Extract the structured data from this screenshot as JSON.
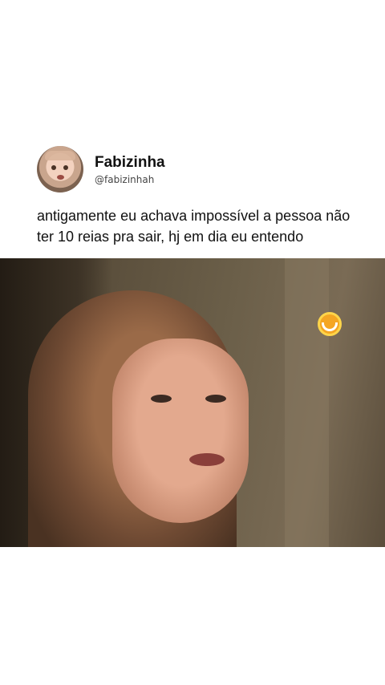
{
  "profile": {
    "name": "Fabizinha",
    "handle": "@fabizinhah"
  },
  "post": {
    "caption": "antigamente eu achava impossível a pessoa não ter 10 reias pra sair, hj em dia eu entendo"
  },
  "media": {
    "type": "video",
    "logo_icon": "smile-logo-icon",
    "logo_color": "#f5a623"
  }
}
